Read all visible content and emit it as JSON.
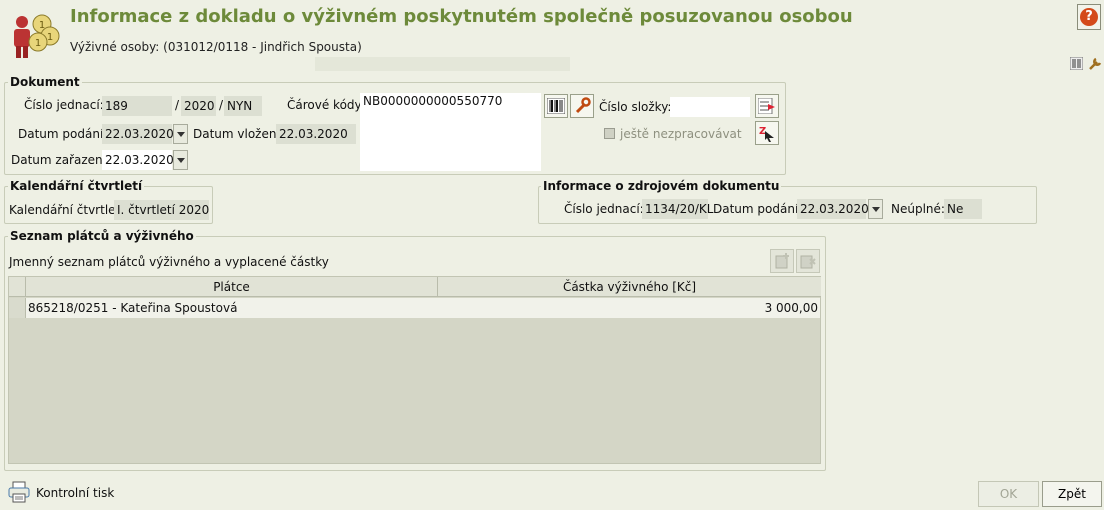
{
  "header": {
    "title": "Informace z dokladu o výživném poskytnutém společně posuzovanou osobou",
    "subtitle": "Výživné osoby: (031012/0118 - Jindřich Spousta)"
  },
  "dokument": {
    "group_title": "Dokument",
    "cislo_jednaci_label": "Číslo jednací:",
    "cislo_jednaci": "189",
    "cislo_rok": "2020",
    "cislo_kod": "NYN",
    "datum_podani_label": "Datum podání:",
    "datum_podani": "22.03.2020",
    "datum_vlozeni_label": "Datum vložení:",
    "datum_vlozeni": "22.03.2020",
    "datum_zarazeni_label": "Datum zařazení:",
    "datum_zarazeni": "22.03.2020",
    "carove_kody_label": "Čárové kódy:",
    "carove_kody": "NB0000000000550770",
    "cislo_slozky_label": "Číslo složky:",
    "cislo_slozky": "",
    "jeste_nezpracovavat": "ještě nezpracovávat"
  },
  "kalendar": {
    "group_title": "Kalendářní čtvrtletí",
    "label": "Kalendářní čtvrtletí:",
    "value": "I. čtvrtletí 2020"
  },
  "zdroj": {
    "group_title": "Informace o zdrojovém dokumentu",
    "cislo_jednaci_label": "Číslo jednací:",
    "cislo_jednaci": "1134/20/KL",
    "datum_podani_label": "Datum podání:",
    "datum_podani": "22.03.2020",
    "neuplne_label": "Neúplné:",
    "neuplne": "Ne"
  },
  "seznam": {
    "group_title": "Seznam plátců a výživného",
    "description": "Jmenný seznam plátců výživného a vyplacené částky",
    "columns": [
      "Plátce",
      "Částka výživného [Kč]"
    ],
    "rows": [
      {
        "platce": "865218/0251 - Kateřina Spoustová",
        "castka": "3 000,00"
      }
    ]
  },
  "footer": {
    "kontrolni_tisk": "Kontrolní tisk",
    "ok": "OK",
    "zpet": "Zpět"
  },
  "icons": {
    "app": "coins-person-icon",
    "help": "help-icon"
  },
  "colors": {
    "title": "#6d8a3a",
    "background": "#eef0e4"
  }
}
